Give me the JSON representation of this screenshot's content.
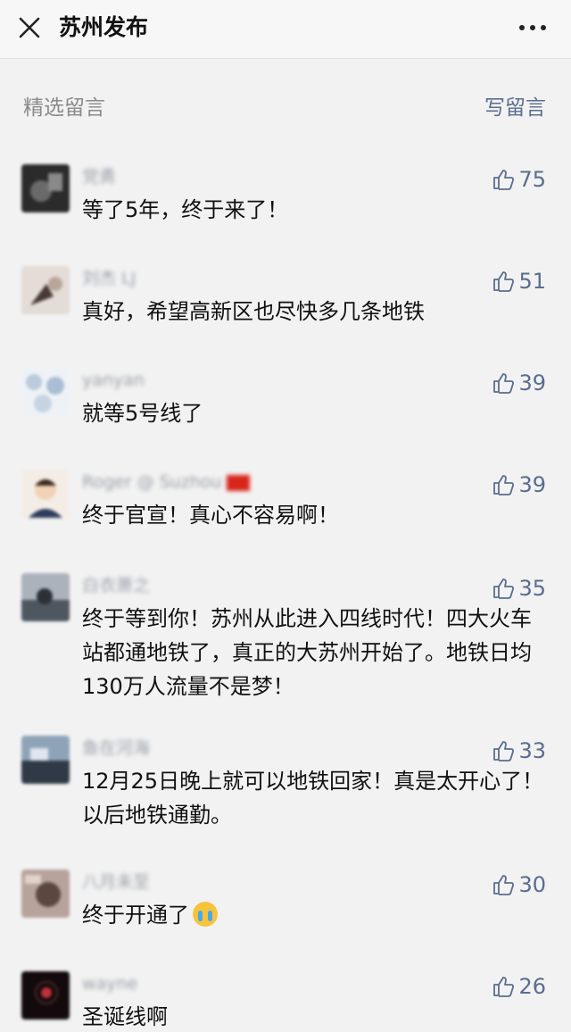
{
  "header": {
    "title": "苏州发布",
    "close_icon": "close-icon",
    "more_icon": "more-horizontal-icon"
  },
  "section": {
    "label": "精选留言",
    "write_label": "写留言"
  },
  "colors": {
    "link": "#5a6d8f",
    "muted": "#8a8a8a",
    "background": "#f2f2f2"
  },
  "comments": [
    {
      "nickname": "党勇",
      "text": "等了5年，终于来了！",
      "likes": "75",
      "avatar_color": "#3a3a3a"
    },
    {
      "nickname": "刘杰 LJ",
      "text": "真好，希望高新区也尽快多几条地铁",
      "likes": "51",
      "avatar_color": "#d7d0cc"
    },
    {
      "nickname": "yanyan",
      "text": "就等5号线了",
      "likes": "39",
      "avatar_color": "#c9d6e2"
    },
    {
      "nickname": "Roger @ Suzhou",
      "text": "终于官宣！真心不容易啊！",
      "likes": "39",
      "avatar_color": "#e8d9c8"
    },
    {
      "nickname": "白衣萧之",
      "text": "终于等到你！苏州从此进入四线时代！四大火车站都通地铁了，真正的大苏州开始了。地铁日均130万人流量不是梦！",
      "likes": "35",
      "avatar_color": "#6e7680"
    },
    {
      "nickname": "鱼在河海",
      "text": "12月25日晚上就可以地铁回家！真是太开心了！以后地铁通勤。",
      "likes": "33",
      "avatar_color": "#55606e"
    },
    {
      "nickname": "八月未至",
      "text": "终于开通了",
      "likes": "30",
      "avatar_color": "#8a6f6a"
    },
    {
      "nickname": "wayne",
      "text": "圣诞线啊",
      "likes": "26",
      "avatar_color": "#1a1012"
    }
  ]
}
